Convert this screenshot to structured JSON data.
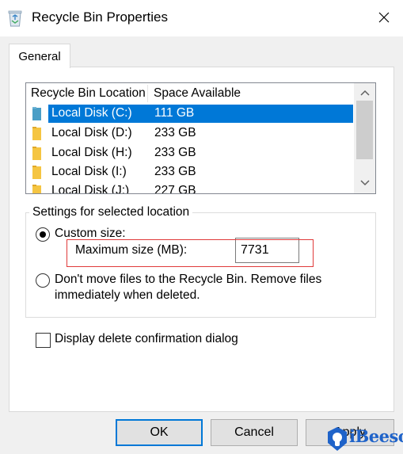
{
  "window": {
    "title": "Recycle Bin Properties",
    "icon": "recycle-bin-icon",
    "close_icon": "close-icon"
  },
  "tabs": [
    {
      "label": "General",
      "active": true
    }
  ],
  "list": {
    "columns": [
      "Recycle Bin Location",
      "Space Available"
    ],
    "rows": [
      {
        "location": "Local Disk (C:)",
        "space": "111 GB",
        "selected": true
      },
      {
        "location": "Local Disk (D:)",
        "space": "233 GB",
        "selected": false
      },
      {
        "location": "Local Disk (H:)",
        "space": "233 GB",
        "selected": false
      },
      {
        "location": "Local Disk (I:)",
        "space": "233 GB",
        "selected": false
      },
      {
        "location": "Local Disk (J:)",
        "space": "227 GB",
        "selected": false
      }
    ],
    "scroll_up_icon": "chevron-up-icon",
    "scroll_down_icon": "chevron-down-icon"
  },
  "settings": {
    "group_label": "Settings for selected location",
    "custom_size_label": "Custom size:",
    "custom_size_selected": true,
    "max_size_label": "Maximum size (MB):",
    "max_size_value": "7731",
    "dont_move_label_line1": "Don't move files to the Recycle Bin. Remove files",
    "dont_move_label_line2": "immediately when deleted.",
    "dont_move_selected": false
  },
  "confirm": {
    "label": "Display delete confirmation dialog",
    "checked": false
  },
  "buttons": {
    "ok": "OK",
    "cancel": "Cancel",
    "apply": "Apply"
  },
  "watermark": {
    "text": "iBeesoft",
    "logo": "ibeesoft-logo-icon"
  },
  "colors": {
    "selection": "#0078d7",
    "folder": "#f5c542",
    "highlight_box": "#e03a3a",
    "watermark": "#1f63c9"
  }
}
